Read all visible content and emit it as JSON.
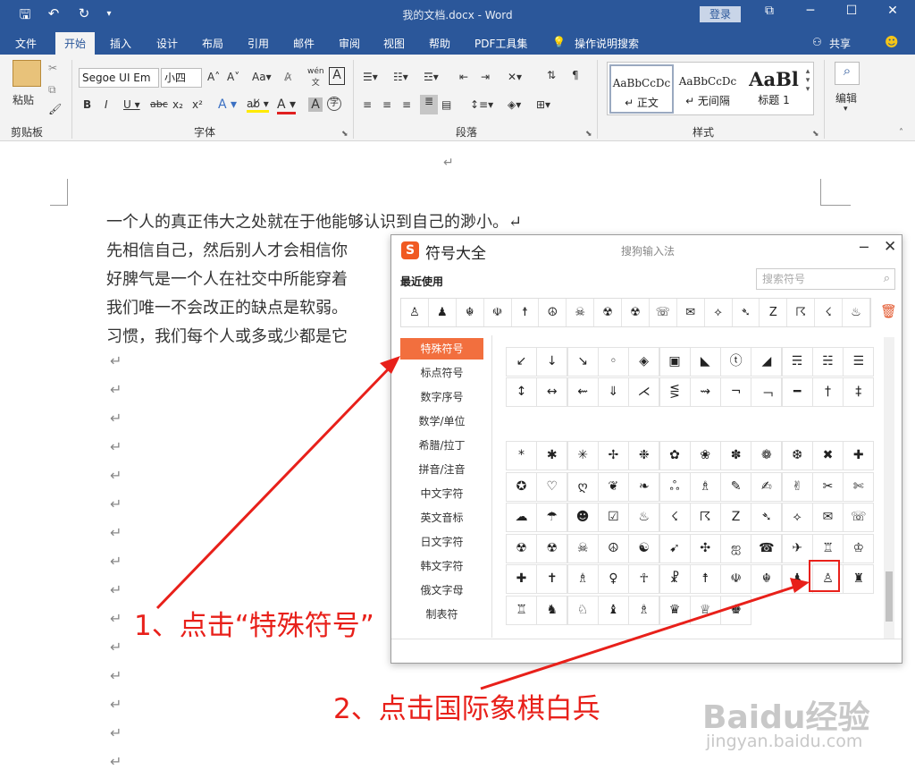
{
  "titlebar": {
    "doc_title": "我的文档.docx  -  Word",
    "login": "登录"
  },
  "tabs": [
    "文件",
    "开始",
    "插入",
    "设计",
    "布局",
    "引用",
    "邮件",
    "审阅",
    "视图",
    "帮助",
    "PDF工具集",
    "操作说明搜索",
    "共享"
  ],
  "ribbon": {
    "paste_label": "粘贴",
    "clipboard_label": "剪贴板",
    "font_name": "Segoe UI Em",
    "font_size": "小四",
    "font_label": "字体",
    "paragraph_label": "段落",
    "styles_label": "样式",
    "edit_label": "编辑",
    "styles": [
      {
        "sample": "AaBbCcDc",
        "name": "↵ 正文"
      },
      {
        "sample": "AaBbCcDc",
        "name": "↵ 无间隔"
      },
      {
        "sample": "AaBl",
        "name": "标题 1"
      }
    ]
  },
  "document": {
    "lines": [
      "一个人的真正伟大之处就在于他能够认识到自己的渺小。↵",
      "先相信自己，然后别人才会相信你",
      "好脾气是一个人在社交中所能穿着",
      "我们唯一不会改正的缺点是软弱。",
      "习惯，我们每个人或多或少都是它"
    ],
    "para_mark": "↵"
  },
  "dialog": {
    "title": "符号大全",
    "logo": "S",
    "brand": "搜狗输入法",
    "recent_label": "最近使用",
    "search_placeholder": "搜索符号",
    "recent": [
      "♙",
      "♟",
      "☬",
      "☫",
      "☨",
      "☮",
      "☠",
      "☢",
      "☢",
      "☏",
      "✉",
      "⟡",
      "➴",
      "Z",
      "☈",
      "☇",
      "♨"
    ],
    "categories": [
      "特殊符号",
      "标点符号",
      "数字序号",
      "数学/单位",
      "希腊/拉丁",
      "拼音/注音",
      "中文字符",
      "英文音标",
      "日文字符",
      "韩文字符",
      "俄文字母",
      "制表符"
    ],
    "active_category": "特殊符号",
    "grid_top": [
      [
        "↙",
        "↓",
        "↘",
        "◦",
        "◈",
        "▣",
        "◣",
        "ⓣ",
        "◢",
        "☴",
        "☵",
        "☰"
      ],
      [
        "↕",
        "↔",
        "⇜",
        "⇓",
        "⋌",
        "⋚",
        "⇝",
        "¬",
        "﹁",
        "━",
        "†",
        "‡"
      ]
    ],
    "grid_bottom": [
      [
        "*",
        "✱",
        "✳",
        "✢",
        "❉",
        "✿",
        "❀",
        "✽",
        "❁",
        "❆",
        "✖",
        "✚"
      ],
      [
        "✪",
        "♡",
        "ღ",
        "❦",
        "❧",
        "ஃ",
        "♗",
        "✎",
        "✍",
        "✌",
        "✂",
        "✄"
      ],
      [
        "☁",
        "☂",
        "☻",
        "☑",
        "♨",
        "☇",
        "☈",
        "Z",
        "➴",
        "⟡",
        "✉",
        "☏"
      ],
      [
        "☢",
        "☢",
        "☠",
        "☮",
        "☯",
        "➹",
        "✣",
        "ஐ",
        "☎",
        "✈",
        "♖",
        "♔"
      ],
      [
        "✚",
        "✝",
        "♗",
        "♀",
        "☥",
        "☧",
        "☨",
        "☫",
        "☬",
        "♟",
        "♙",
        "♜"
      ],
      [
        "♖",
        "♞",
        "♘",
        "♝",
        "♗",
        "♛",
        "♕",
        "♚"
      ]
    ]
  },
  "annotations": {
    "step1": "1、点击“特殊符号”",
    "step2": "2、点击国际象棋白兵"
  },
  "watermark": {
    "brand": "Baidu经验",
    "url": "jingyan.baidu.com"
  }
}
